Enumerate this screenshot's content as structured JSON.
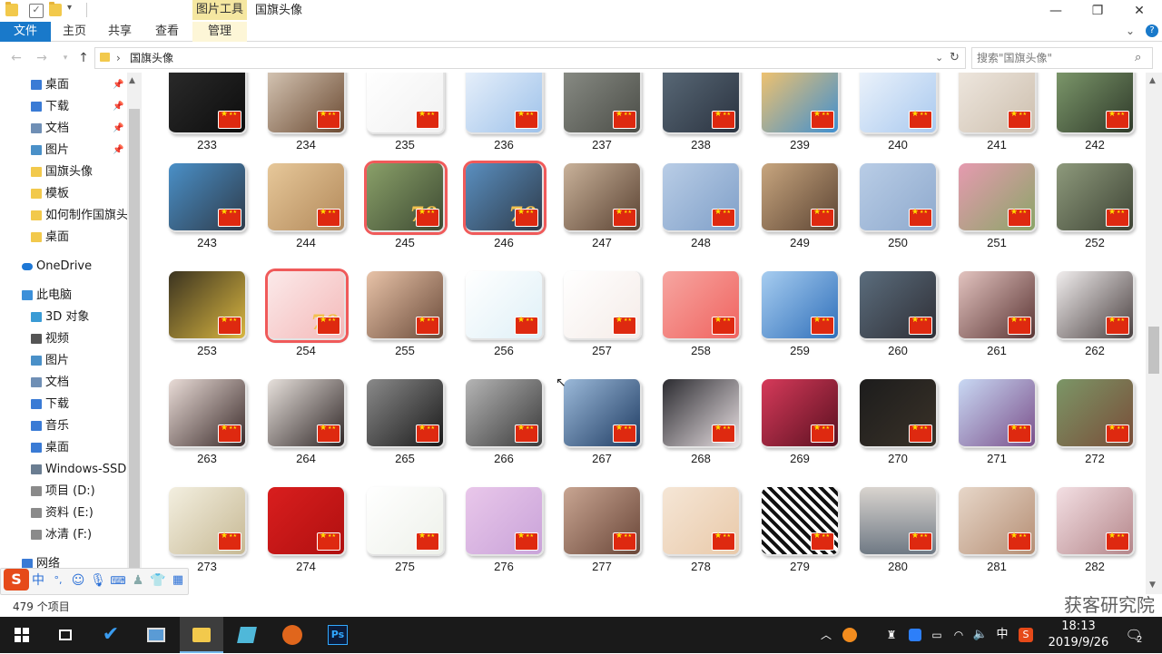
{
  "window": {
    "title": "国旗头像",
    "context_tab": "图片工具",
    "controls": {
      "minimize": "—",
      "restore": "❐",
      "close": "✕"
    }
  },
  "ribbon": {
    "tabs": [
      "文件",
      "主页",
      "共享",
      "查看",
      "管理"
    ],
    "collapse_icon": "chevron-down-icon",
    "help_icon": "help-icon"
  },
  "address": {
    "path": "国旗头像",
    "separator": "›",
    "search_placeholder": "搜索\"国旗头像\""
  },
  "nav": {
    "items": [
      {
        "label": "桌面",
        "icon": "desktop-folder-icon",
        "color": "#3a7bd5",
        "pinned": true
      },
      {
        "label": "下载",
        "icon": "download-folder-icon",
        "color": "#3a7bd5",
        "pinned": true
      },
      {
        "label": "文档",
        "icon": "documents-folder-icon",
        "color": "#6f8fb5",
        "pinned": true
      },
      {
        "label": "图片",
        "icon": "pictures-folder-icon",
        "color": "#4a90c8",
        "pinned": true
      },
      {
        "label": "国旗头像",
        "icon": "folder-icon",
        "color": "#f2c94c",
        "pinned": false
      },
      {
        "label": "模板",
        "icon": "folder-icon",
        "color": "#f2c94c",
        "pinned": false
      },
      {
        "label": "如何制作国旗头像",
        "icon": "folder-icon",
        "color": "#f2c94c",
        "pinned": false
      },
      {
        "label": "桌面",
        "icon": "folder-icon",
        "color": "#f2c94c",
        "pinned": false
      },
      {
        "label": "OneDrive",
        "icon": "onedrive-icon",
        "color": "#1e78d6",
        "pinned": false
      },
      {
        "label": "此电脑",
        "icon": "pc-icon",
        "color": "#3b8fd9",
        "pinned": false
      },
      {
        "label": "3D 对象",
        "icon": "3d-objects-icon",
        "color": "#3a9bd5",
        "pinned": false
      },
      {
        "label": "视频",
        "icon": "videos-icon",
        "color": "#555555",
        "pinned": false
      },
      {
        "label": "图片",
        "icon": "pictures-folder-icon",
        "color": "#4a90c8",
        "pinned": false
      },
      {
        "label": "文档",
        "icon": "documents-folder-icon",
        "color": "#6f8fb5",
        "pinned": false
      },
      {
        "label": "下载",
        "icon": "download-folder-icon",
        "color": "#3a7bd5",
        "pinned": false
      },
      {
        "label": "音乐",
        "icon": "music-folder-icon",
        "color": "#3a7bd5",
        "pinned": false
      },
      {
        "label": "桌面",
        "icon": "desktop-folder-icon",
        "color": "#3a7bd5",
        "pinned": false
      },
      {
        "label": "Windows-SSD (",
        "icon": "system-drive-icon",
        "color": "#6a7d91",
        "pinned": false
      },
      {
        "label": "项目 (D:)",
        "icon": "drive-icon",
        "color": "#8a8a8a",
        "pinned": false
      },
      {
        "label": "资料 (E:)",
        "icon": "drive-icon",
        "color": "#8a8a8a",
        "pinned": false
      },
      {
        "label": "冰清 (F:)",
        "icon": "drive-icon",
        "color": "#8a8a8a",
        "pinned": false
      },
      {
        "label": "网络",
        "icon": "network-icon",
        "color": "#3a7bd5",
        "pinned": false
      }
    ]
  },
  "files": [
    {
      "name": "233",
      "bg": "linear-gradient(135deg,#2b2b2b,#0d0d0d)"
    },
    {
      "name": "234",
      "bg": "linear-gradient(135deg,#d8c9b8,#6b4a32)"
    },
    {
      "name": "235",
      "bg": "linear-gradient(135deg,#ffffff,#f1f1f1)"
    },
    {
      "name": "236",
      "bg": "linear-gradient(135deg,#e9f1fb,#9ec2ea)"
    },
    {
      "name": "237",
      "bg": "linear-gradient(135deg,#8a8d86,#4b4d47)"
    },
    {
      "name": "238",
      "bg": "linear-gradient(135deg,#5a6a78,#2b3340)"
    },
    {
      "name": "239",
      "bg": "linear-gradient(135deg,#f7c46a,#3f8fd0)"
    },
    {
      "name": "240",
      "bg": "linear-gradient(135deg,#eef4fb,#a9c9ef)"
    },
    {
      "name": "241",
      "bg": "linear-gradient(135deg,#efe8e0,#cdbfae)"
    },
    {
      "name": "242",
      "bg": "linear-gradient(135deg,#7f9b6d,#2f3a2a)"
    },
    {
      "name": "243",
      "bg": "linear-gradient(135deg,#4a90c8,#2e3b4a)"
    },
    {
      "name": "244",
      "bg": "linear-gradient(135deg,#e7c89a,#b2895a)"
    },
    {
      "name": "245",
      "bg": "linear-gradient(135deg,#8aa069,#3d4a32)",
      "badge": "70",
      "frame": "#f05a5a"
    },
    {
      "name": "246",
      "bg": "linear-gradient(135deg,#5a8fc0,#2e3b4a)",
      "badge": "70",
      "frame": "#f05a5a"
    },
    {
      "name": "247",
      "bg": "linear-gradient(135deg,#c9b29a,#5a4232)"
    },
    {
      "name": "248",
      "bg": "linear-gradient(135deg,#b9cde6,#7f9fc8)"
    },
    {
      "name": "249",
      "bg": "linear-gradient(135deg,#c8a67f,#5c4433)"
    },
    {
      "name": "250",
      "bg": "linear-gradient(135deg,#b9cde6,#8ea9cd)"
    },
    {
      "name": "251",
      "bg": "linear-gradient(135deg,#e69ab0,#8aa567)"
    },
    {
      "name": "252",
      "bg": "linear-gradient(135deg,#8e9a7c,#3e4435)"
    },
    {
      "name": "253",
      "bg": "linear-gradient(135deg,#3b3320,#d9b640)"
    },
    {
      "name": "254",
      "bg": "linear-gradient(135deg,#fbeaea,#f4b9b9)",
      "badge": "70",
      "frame": "#f05a5a"
    },
    {
      "name": "255",
      "bg": "linear-gradient(135deg,#e8c3a8,#6b4b3a)"
    },
    {
      "name": "256",
      "bg": "linear-gradient(135deg,#ffffff,#dff0f7)"
    },
    {
      "name": "257",
      "bg": "linear-gradient(135deg,#ffffff,#f5ece8)"
    },
    {
      "name": "258",
      "bg": "linear-gradient(135deg,#f6a6a1,#f0635f)"
    },
    {
      "name": "259",
      "bg": "linear-gradient(135deg,#a7cdf0,#2f6fba)"
    },
    {
      "name": "260",
      "bg": "linear-gradient(135deg,#5b6d7d,#2f2f36)"
    },
    {
      "name": "261",
      "bg": "linear-gradient(135deg,#e3c4c0,#5a3433)"
    },
    {
      "name": "262",
      "bg": "linear-gradient(135deg,#f1eeee,#4a4040)"
    },
    {
      "name": "263",
      "bg": "linear-gradient(135deg,#e9dcd7,#3b2b2a)"
    },
    {
      "name": "264",
      "bg": "linear-gradient(135deg,#e7e1dc,#2f2626)"
    },
    {
      "name": "265",
      "bg": "linear-gradient(135deg,#8a8a8a,#1a1a1a)"
    },
    {
      "name": "266",
      "bg": "linear-gradient(135deg,#b5b5b5,#3a3a3a)"
    },
    {
      "name": "267",
      "bg": "linear-gradient(135deg,#9bb9d9,#1f3c63)"
    },
    {
      "name": "268",
      "bg": "linear-gradient(135deg,#2b2b30,#e9e0e3)"
    },
    {
      "name": "269",
      "bg": "linear-gradient(135deg,#d63a5a,#5a1020)"
    },
    {
      "name": "270",
      "bg": "linear-gradient(135deg,#1c1c1c,#3a3228)"
    },
    {
      "name": "271",
      "bg": "linear-gradient(135deg,#c9d9f4,#7a4f8a)"
    },
    {
      "name": "272",
      "bg": "linear-gradient(135deg,#7b9667,#7a4d38)"
    },
    {
      "name": "273",
      "bg": "linear-gradient(135deg,#f3efe0,#c7b994)"
    },
    {
      "name": "274",
      "bg": "linear-gradient(135deg,#d91e1e,#b01010)"
    },
    {
      "name": "275",
      "bg": "linear-gradient(135deg,#ffffff,#eef1ea)"
    },
    {
      "name": "276",
      "bg": "linear-gradient(135deg,#e9c7ea,#c9a3d9)"
    },
    {
      "name": "277",
      "bg": "linear-gradient(135deg,#c8a592,#6a4638)"
    },
    {
      "name": "278",
      "bg": "linear-gradient(135deg,#f5e6d6,#e9c9a9)"
    },
    {
      "name": "279",
      "bg": "repeating-linear-gradient(45deg,#111 0 4px,#fff 4px 8px)"
    },
    {
      "name": "280",
      "bg": "linear-gradient(180deg,#d9d4cf,#6f7984)"
    },
    {
      "name": "281",
      "bg": "linear-gradient(135deg,#e7d7c9,#b58e74)"
    },
    {
      "name": "282",
      "bg": "linear-gradient(135deg,#f3dfe3,#b4868a)"
    }
  ],
  "status": {
    "item_count": "479 个项目"
  },
  "watermark": "获客研究院",
  "ime": {
    "icons": [
      "sogou-logo-icon",
      "chinese-mode-icon",
      "punctuation-icon",
      "emoji-icon",
      "microphone-icon",
      "keyboard-icon",
      "user-icon",
      "skin-icon",
      "toolbox-icon"
    ],
    "mode": "中",
    "punct": "°,"
  },
  "taskbar": {
    "apps": [
      {
        "icon": "windows-start-icon"
      },
      {
        "icon": "task-view-icon"
      },
      {
        "icon": "todo-check-icon"
      },
      {
        "icon": "computer-icon"
      },
      {
        "icon": "file-explorer-icon",
        "active": true
      },
      {
        "icon": "notes-app-icon"
      },
      {
        "icon": "app-avatar-icon"
      },
      {
        "icon": "photoshop-icon",
        "label": "Ps"
      }
    ],
    "tray": {
      "ime_mode": "中",
      "time": "18:13",
      "date": "2019/9/26",
      "notification_count": "2"
    }
  }
}
